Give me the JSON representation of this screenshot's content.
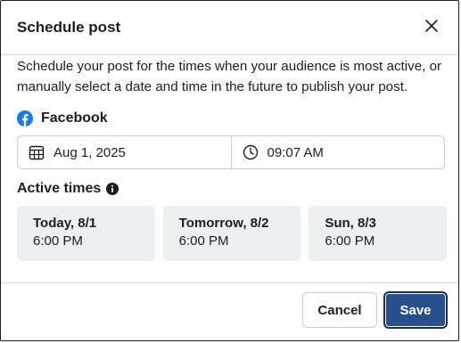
{
  "dialog": {
    "title": "Schedule post",
    "description": "Schedule your post for the times when your audience is most active, or manually select a date and time in the future to publish your post."
  },
  "platform": {
    "name": "Facebook",
    "icon": "facebook-icon",
    "color": "#1877f2"
  },
  "schedule": {
    "date": "Aug 1, 2025",
    "time": "09:07 AM"
  },
  "active_times": {
    "label": "Active times",
    "slots": [
      {
        "day": "Today, 8/1",
        "time": "6:00 PM"
      },
      {
        "day": "Tomorrow, 8/2",
        "time": "6:00 PM"
      },
      {
        "day": "Sun, 8/3",
        "time": "6:00 PM"
      }
    ]
  },
  "buttons": {
    "cancel": "Cancel",
    "save": "Save"
  },
  "colors": {
    "primary": "#28508c",
    "slot_bg": "#eeeff1"
  }
}
